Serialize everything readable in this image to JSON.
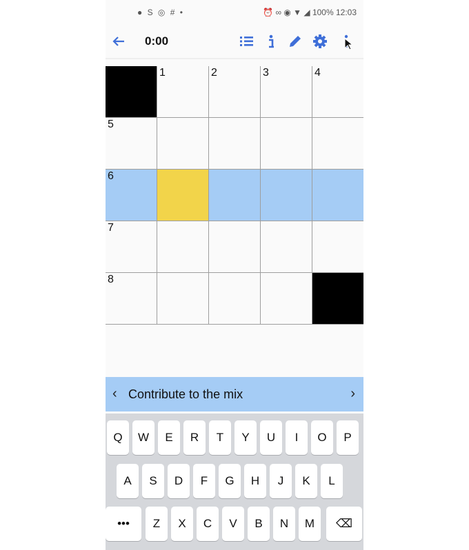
{
  "status_bar": {
    "left_icons": "● S ◎ # •",
    "right_text": "⏰ ∞ ◉ ▼ ◢ 100% 12:03"
  },
  "app_bar": {
    "timer": "0:00",
    "icons": [
      "back-arrow-icon",
      "clue-list-icon",
      "info-icon",
      "pencil-icon",
      "gear-icon",
      "more-vert-icon"
    ],
    "accent_color": "#3f6fd8"
  },
  "grid": {
    "rows": [
      [
        {
          "num": "",
          "black": true
        },
        {
          "num": "1"
        },
        {
          "num": "2"
        },
        {
          "num": "3"
        },
        {
          "num": "4"
        }
      ],
      [
        {
          "num": "5"
        },
        {
          "num": ""
        },
        {
          "num": ""
        },
        {
          "num": ""
        },
        {
          "num": ""
        }
      ],
      [
        {
          "num": "6"
        },
        {
          "num": ""
        },
        {
          "num": ""
        },
        {
          "num": ""
        },
        {
          "num": ""
        }
      ],
      [
        {
          "num": "7"
        },
        {
          "num": ""
        },
        {
          "num": ""
        },
        {
          "num": ""
        },
        {
          "num": ""
        }
      ],
      [
        {
          "num": "8"
        },
        {
          "num": ""
        },
        {
          "num": ""
        },
        {
          "num": ""
        },
        {
          "num": "",
          "black": true
        }
      ]
    ],
    "highlight_row": 2,
    "selected_cell": [
      2,
      1
    ],
    "highlight_color": "#a5ccf5",
    "selected_color": "#f2d44a"
  },
  "clue_bar": {
    "prev": "‹",
    "text": "Contribute to the mix",
    "next": "›"
  },
  "keyboard": {
    "row1": [
      "Q",
      "W",
      "E",
      "R",
      "T",
      "Y",
      "U",
      "I",
      "O",
      "P"
    ],
    "row2": [
      "A",
      "S",
      "D",
      "F",
      "G",
      "H",
      "J",
      "K",
      "L"
    ],
    "row3": [
      "•••",
      "Z",
      "X",
      "C",
      "V",
      "B",
      "N",
      "M",
      "⌫"
    ]
  }
}
